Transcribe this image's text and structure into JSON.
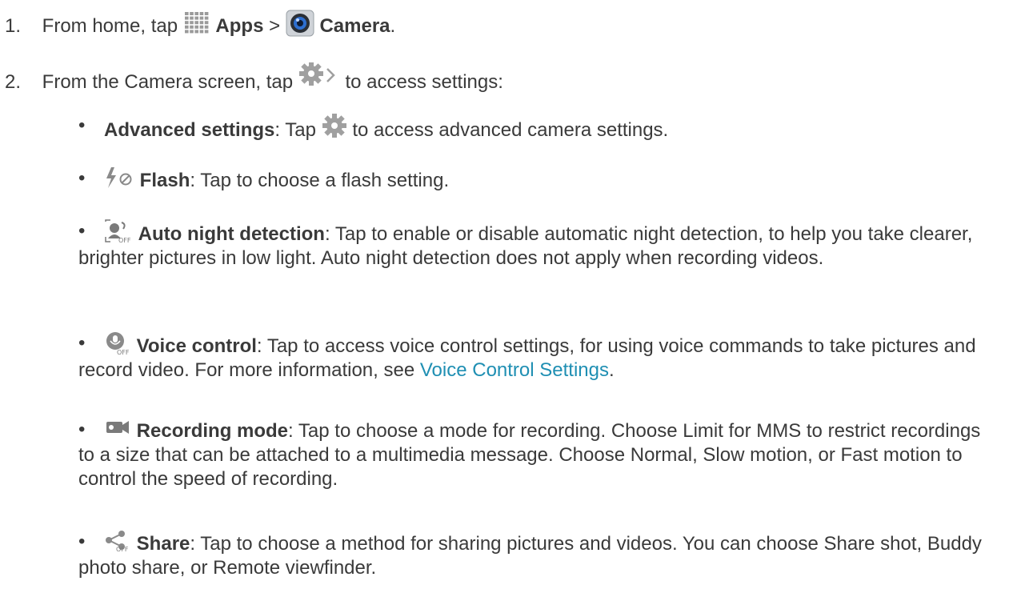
{
  "step1": {
    "number": "1.",
    "pre": "From home, tap",
    "apps": "Apps",
    "sep": ">",
    "camera": "Camera",
    "post": "."
  },
  "step2": {
    "number": "2.",
    "pre": "From the Camera screen, tap",
    "post": "to access settings:"
  },
  "items": [
    {
      "icon": "gear-icon",
      "label": "Advanced settings",
      "pre": ": Tap",
      "text": "to access advanced camera settings."
    },
    {
      "icon": "flash-off-icon",
      "label": "Flash",
      "text": ": Tap to choose a flash setting."
    },
    {
      "icon": "night-detection-off-icon",
      "label": "Auto night detection",
      "text": ": Tap to enable or disable automatic night detection, to help you take clearer, brighter pictures in low light. Auto night detection does not apply when recording videos."
    },
    {
      "icon": "voice-control-off-icon",
      "label": "Voice control",
      "text": ": Tap to access voice control settings, for using voice commands to take pictures and record video. For more information, see",
      "link": "Voice Control Settings",
      "end": "."
    },
    {
      "icon": "recording-mode-icon",
      "label": "Recording mode",
      "text": ": Tap to choose a mode for recording. Choose Limit for MMS to restrict recordings to a size that can be attached to a multimedia message. Choose Normal, Slow motion, or Fast motion to control the speed of recording."
    },
    {
      "icon": "share-off-icon",
      "label": "Share",
      "text": ": Tap to choose a method for sharing pictures and videos. You can choose Share shot, Buddy photo share, or Remote viewfinder."
    }
  ],
  "colors": {
    "text": "#3a3a3a",
    "link": "#1f8fb3"
  }
}
